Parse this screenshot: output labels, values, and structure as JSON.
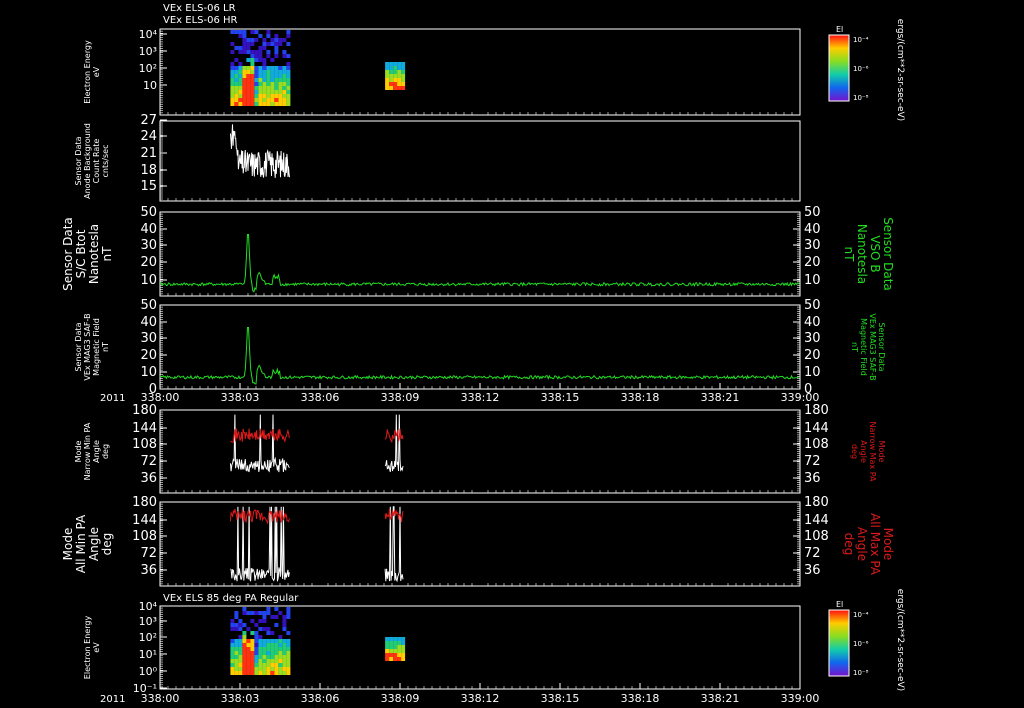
{
  "header": {
    "line1": "VEx ELS-06 LR",
    "line2": "VEx ELS-06 HR"
  },
  "colors": {
    "background": "#000000",
    "axes": "#ffffff",
    "trace_main": "#ffffff",
    "trace_green": "#22dd22",
    "trace_red": "#dd1a1a"
  },
  "x_axis": {
    "year_label": "2011",
    "tick_labels": [
      "338:00",
      "338:03",
      "338:06",
      "338:09",
      "338:12",
      "338:15",
      "338:18",
      "338:21",
      "339:00"
    ],
    "range_minutes": [
      0,
      60
    ]
  },
  "colorbar": {
    "title": "El",
    "unit_label": "ergs/(cm**2-sr-sec-eV)",
    "top_label": "10⁻⁴",
    "mid_label": "10⁻⁶",
    "bottom_label": "10⁻⁸"
  },
  "panels": [
    {
      "id": "p1",
      "type": "heatmap",
      "left_label": [
        "Electron Energy",
        "eV"
      ],
      "y_scale": "log",
      "ylim": [
        1,
        10000
      ],
      "tick_labels": [
        "10",
        "10²",
        "10³",
        "10⁴"
      ],
      "colorbar": true
    },
    {
      "id": "p2",
      "type": "line",
      "left_label": [
        "Sensor Data",
        "Anode Background",
        "Count Rate",
        "cnts/sec"
      ],
      "ylim": [
        13,
        27
      ],
      "tick_labels": [
        "15",
        "18",
        "21",
        "24",
        "27"
      ]
    },
    {
      "id": "p3",
      "type": "line",
      "left_label": [
        "Sensor Data",
        "S/C Btot",
        "Nanotesla",
        "nT"
      ],
      "right_label": [
        "Sensor Data",
        "VSO B",
        "Nanotesla",
        "nT"
      ],
      "ylim": [
        0,
        50
      ],
      "tick_labels": [
        "10",
        "20",
        "30",
        "40",
        "50"
      ]
    },
    {
      "id": "p4",
      "type": "line",
      "left_label": [
        "Sensor Data",
        "VEx MAG3 SAF-B",
        "Magnetic Field",
        "nT"
      ],
      "right_label": [
        "Sensor Data",
        "VEx MAG3 SAF-B",
        "Magnetic Field",
        "nT"
      ],
      "ylim": [
        0,
        50
      ],
      "tick_labels": [
        "0",
        "10",
        "20",
        "30",
        "40",
        "50"
      ],
      "show_time_ticks": true
    },
    {
      "id": "p5",
      "type": "line",
      "left_label": [
        "Mode",
        "Narrow Min PA",
        "Angle",
        "deg"
      ],
      "right_label": [
        "Mode",
        "Narrow Max PA",
        "Angle",
        "deg"
      ],
      "ylim": [
        0,
        180
      ],
      "tick_labels": [
        "36",
        "72",
        "108",
        "144",
        "180"
      ]
    },
    {
      "id": "p6",
      "type": "line",
      "left_label": [
        "Mode",
        "All Min PA",
        "Angle",
        "deg"
      ],
      "right_label": [
        "Mode",
        "All Max PA",
        "Angle",
        "deg"
      ],
      "ylim": [
        0,
        180
      ],
      "tick_labels": [
        "36",
        "72",
        "108",
        "144",
        "180"
      ]
    },
    {
      "id": "p7",
      "type": "heatmap",
      "title": "VEx ELS 85 deg PA Regular",
      "left_label": [
        "Electron Energy",
        "eV"
      ],
      "y_scale": "log",
      "ylim": [
        0.1,
        10000
      ],
      "tick_labels": [
        "10⁻¹",
        "10⁰",
        "10¹",
        "10²",
        "10³",
        "10⁴"
      ],
      "colorbar": true,
      "show_time_ticks": true
    }
  ],
  "chart_data": [
    {
      "type": "heatmap",
      "title": "VEx ELS-06 LR / VEx ELS-06 HR",
      "ylabel": "Electron Energy eV",
      "yscale": "log",
      "ylim": [
        1,
        10000
      ],
      "data_intervals_minutes": [
        [
          6.6,
          12.2
        ],
        [
          21.1,
          22.8
        ]
      ],
      "peak_flux_minute": 8.0
    },
    {
      "type": "line",
      "ylabel": "Sensor Data Anode Background Count Rate cnts/sec",
      "ylim": [
        13,
        27
      ],
      "interval_minutes": [
        6.6,
        12.2
      ],
      "typical_range": [
        17,
        22
      ],
      "max": 27
    },
    {
      "type": "line",
      "ylabel": "Sensor Data S/C Btot Nanotesla nT",
      "ylim": [
        0,
        50
      ],
      "baseline": 7,
      "peak": {
        "minute": 8.2,
        "value": 39
      }
    },
    {
      "type": "line",
      "ylabel": "Sensor Data VEx MAG3 SAF-B Magnetic Field nT",
      "ylim": [
        0,
        50
      ],
      "baseline": 7,
      "peak": {
        "minute": 8.2,
        "value": 39
      }
    },
    {
      "type": "line",
      "ylabel": "Mode Narrow Min/Max PA Angle deg",
      "ylim": [
        0,
        180
      ],
      "series": [
        {
          "name": "Narrow Min PA",
          "typical": 60
        },
        {
          "name": "Narrow Max PA",
          "typical": 125
        }
      ]
    },
    {
      "type": "line",
      "ylabel": "Mode All Min/Max PA Angle deg",
      "ylim": [
        0,
        180
      ],
      "series": [
        {
          "name": "All Min PA",
          "typical": 25
        },
        {
          "name": "All Max PA",
          "typical": 150
        }
      ]
    },
    {
      "type": "heatmap",
      "title": "VEx ELS 85 deg PA Regular",
      "ylabel": "Electron Energy eV",
      "yscale": "log",
      "ylim": [
        0.1,
        10000
      ],
      "data_intervals_minutes": [
        [
          6.6,
          12.2
        ],
        [
          21.1,
          22.8
        ]
      ]
    }
  ]
}
